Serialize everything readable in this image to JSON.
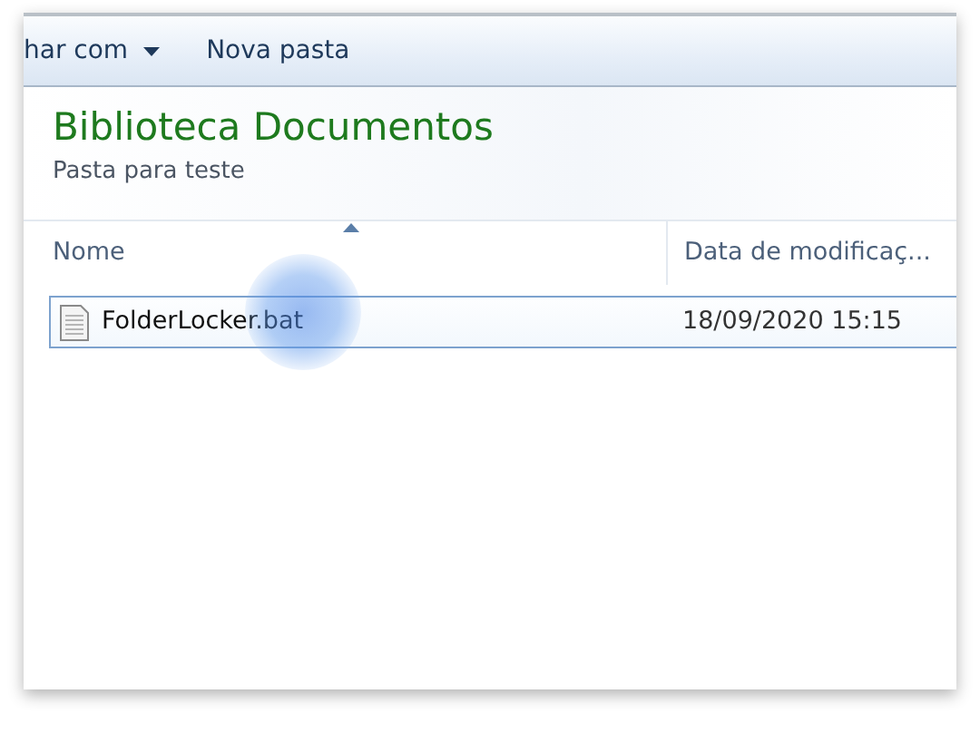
{
  "toolbar": {
    "buttons": [
      {
        "label": "har com",
        "kind": "dropdown"
      },
      {
        "label": "Nova pasta",
        "kind": "plain"
      }
    ]
  },
  "library": {
    "title": "Biblioteca Documentos",
    "subtitle": "Pasta para teste"
  },
  "table": {
    "columns": [
      {
        "label": "Nome",
        "sorted": true
      },
      {
        "label": "Data de modificaç...",
        "sorted": false
      }
    ],
    "rows": [
      {
        "name": "FolderLocker.bat",
        "modified": "18/09/2020 15:15",
        "selected": true
      }
    ]
  }
}
